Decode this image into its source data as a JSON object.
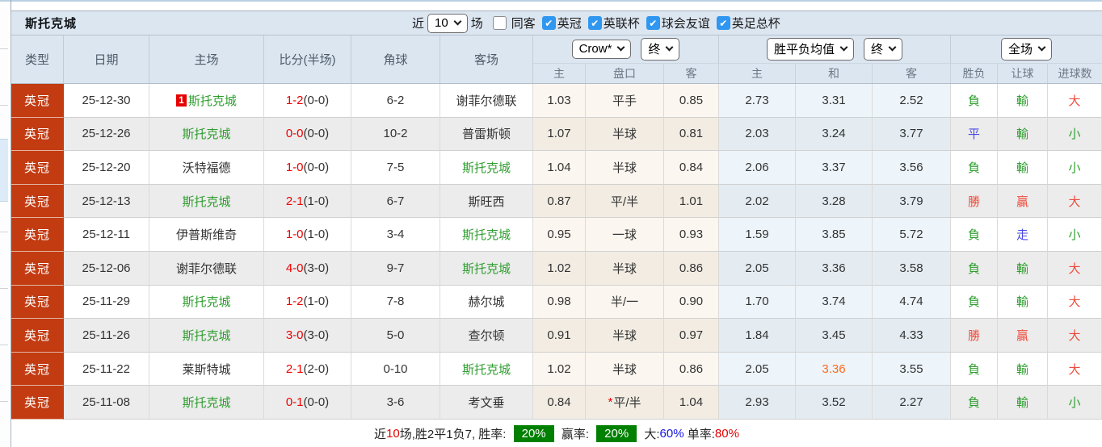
{
  "title": "斯托克城",
  "controls": {
    "near_label": "近",
    "near_value": "10",
    "games_label": "场",
    "filters": [
      {
        "label": "同客",
        "checked": false
      },
      {
        "label": "英冠",
        "checked": true
      },
      {
        "label": "英联杯",
        "checked": true
      },
      {
        "label": "球会友谊",
        "checked": true
      },
      {
        "label": "英足总杯",
        "checked": true
      }
    ]
  },
  "header": {
    "main_columns": [
      "类型",
      "日期",
      "主场",
      "比分(半场)",
      "角球",
      "客场"
    ],
    "groups": [
      {
        "selects": [
          "Crow*",
          "终"
        ],
        "sub": [
          "主",
          "盘口",
          "客"
        ]
      },
      {
        "selects": [
          "胜平负均值",
          "终"
        ],
        "sub": [
          "主",
          "和",
          "客"
        ]
      },
      {
        "selects": [
          "全场"
        ],
        "sub": [
          "胜负",
          "让球",
          "进球数"
        ]
      }
    ]
  },
  "rows": [
    {
      "type": "英冠",
      "date": "25-12-30",
      "badge": "1",
      "home": "斯托克城",
      "home_color": "green",
      "score": "1-2",
      "half": "(0-0)",
      "corner": "6-2",
      "away": "谢菲尔德联",
      "away_color": "dark",
      "odds_home": "1.03",
      "handicap": "平手",
      "odds_away": "0.85",
      "avg_home": "2.73",
      "avg_draw": "3.31",
      "avg_away": "2.52",
      "result_wdl": "負",
      "result_wdl_color": "green",
      "result_handicap": "輸",
      "result_handicap_color": "green",
      "result_goals": "大",
      "result_goals_color": "red"
    },
    {
      "type": "英冠",
      "date": "25-12-26",
      "home": "斯托克城",
      "home_color": "green",
      "score": "0-0",
      "half": "(0-0)",
      "corner": "10-2",
      "away": "普雷斯顿",
      "away_color": "dark",
      "odds_home": "1.07",
      "handicap": "半球",
      "odds_away": "0.81",
      "avg_home": "2.03",
      "avg_draw": "3.24",
      "avg_away": "3.77",
      "result_wdl": "平",
      "result_wdl_color": "blue",
      "result_handicap": "輸",
      "result_handicap_color": "green",
      "result_goals": "小",
      "result_goals_color": "green"
    },
    {
      "type": "英冠",
      "date": "25-12-20",
      "home": "沃特福德",
      "home_color": "dark",
      "score": "1-0",
      "half": "(0-0)",
      "corner": "7-5",
      "away": "斯托克城",
      "away_color": "green",
      "odds_home": "1.04",
      "handicap": "半球",
      "odds_away": "0.84",
      "avg_home": "2.06",
      "avg_draw": "3.37",
      "avg_away": "3.56",
      "result_wdl": "負",
      "result_wdl_color": "green",
      "result_handicap": "輸",
      "result_handicap_color": "green",
      "result_goals": "小",
      "result_goals_color": "green"
    },
    {
      "type": "英冠",
      "date": "25-12-13",
      "home": "斯托克城",
      "home_color": "green",
      "score": "2-1",
      "half": "(1-0)",
      "corner": "6-7",
      "away": "斯旺西",
      "away_color": "dark",
      "odds_home": "0.87",
      "handicap": "平/半",
      "odds_away": "1.01",
      "avg_home": "2.02",
      "avg_draw": "3.28",
      "avg_away": "3.79",
      "result_wdl": "勝",
      "result_wdl_color": "red",
      "result_handicap": "贏",
      "result_handicap_color": "red",
      "result_goals": "大",
      "result_goals_color": "red"
    },
    {
      "type": "英冠",
      "date": "25-12-11",
      "home": "伊普斯维奇",
      "home_color": "dark",
      "score": "1-0",
      "half": "(1-0)",
      "corner": "3-4",
      "away": "斯托克城",
      "away_color": "green",
      "odds_home": "0.95",
      "handicap": "一球",
      "odds_away": "0.93",
      "avg_home": "1.59",
      "avg_draw": "3.85",
      "avg_away": "5.72",
      "result_wdl": "負",
      "result_wdl_color": "green",
      "result_handicap": "走",
      "result_handicap_color": "blue",
      "result_goals": "小",
      "result_goals_color": "green"
    },
    {
      "type": "英冠",
      "date": "25-12-06",
      "home": "谢菲尔德联",
      "home_color": "dark",
      "score": "4-0",
      "half": "(3-0)",
      "corner": "9-7",
      "away": "斯托克城",
      "away_color": "green",
      "odds_home": "1.02",
      "handicap": "半球",
      "odds_away": "0.86",
      "avg_home": "2.05",
      "avg_draw": "3.36",
      "avg_away": "3.58",
      "result_wdl": "負",
      "result_wdl_color": "green",
      "result_handicap": "輸",
      "result_handicap_color": "green",
      "result_goals": "大",
      "result_goals_color": "red"
    },
    {
      "type": "英冠",
      "date": "25-11-29",
      "home": "斯托克城",
      "home_color": "green",
      "score": "1-2",
      "half": "(1-0)",
      "corner": "7-8",
      "away": "赫尔城",
      "away_color": "dark",
      "odds_home": "0.98",
      "handicap": "半/一",
      "odds_away": "0.90",
      "avg_home": "1.70",
      "avg_draw": "3.74",
      "avg_away": "4.74",
      "result_wdl": "負",
      "result_wdl_color": "green",
      "result_handicap": "輸",
      "result_handicap_color": "green",
      "result_goals": "大",
      "result_goals_color": "red"
    },
    {
      "type": "英冠",
      "date": "25-11-26",
      "home": "斯托克城",
      "home_color": "green",
      "score": "3-0",
      "half": "(3-0)",
      "corner": "5-0",
      "away": "查尔顿",
      "away_color": "dark",
      "odds_home": "0.91",
      "handicap": "半球",
      "odds_away": "0.97",
      "avg_home": "1.84",
      "avg_draw": "3.45",
      "avg_away": "4.33",
      "result_wdl": "勝",
      "result_wdl_color": "red",
      "result_handicap": "贏",
      "result_handicap_color": "red",
      "result_goals": "大",
      "result_goals_color": "red"
    },
    {
      "type": "英冠",
      "date": "25-11-22",
      "home": "莱斯特城",
      "home_color": "dark",
      "score": "2-1",
      "half": "(2-0)",
      "corner": "0-10",
      "away": "斯托克城",
      "away_color": "green",
      "odds_home": "1.02",
      "handicap": "半球",
      "odds_away": "0.86",
      "avg_home": "2.05",
      "avg_draw": "3.36",
      "avg_draw_color": "orange",
      "avg_away": "3.55",
      "result_wdl": "負",
      "result_wdl_color": "green",
      "result_handicap": "輸",
      "result_handicap_color": "green",
      "result_goals": "大",
      "result_goals_color": "red"
    },
    {
      "type": "英冠",
      "date": "25-11-08",
      "home": "斯托克城",
      "home_color": "green",
      "score": "0-1",
      "half": "(0-0)",
      "corner": "3-6",
      "away": "考文垂",
      "away_color": "dark",
      "odds_home": "0.84",
      "handicap_star_text": "*",
      "handicap": "平/半",
      "odds_away": "1.04",
      "avg_home": "2.93",
      "avg_draw": "3.52",
      "avg_away": "2.27",
      "result_wdl": "負",
      "result_wdl_color": "green",
      "result_handicap": "輸",
      "result_handicap_color": "green",
      "result_goals": "小",
      "result_goals_color": "green"
    }
  ],
  "footer": {
    "segments": [
      {
        "t": "近",
        "c": "dark"
      },
      {
        "t": "10",
        "c": "red"
      },
      {
        "t": "场,胜2平1负7, 胜率: ",
        "c": "dark"
      },
      {
        "t": "20%",
        "c": "badge"
      },
      {
        "t": " 赢率: ",
        "c": "dark"
      },
      {
        "t": "20%",
        "c": "badge"
      },
      {
        "t": " 大:",
        "c": "dark"
      },
      {
        "t": "60%",
        "c": "blue"
      },
      {
        "t": " 单率:",
        "c": "dark"
      },
      {
        "t": "80%",
        "c": "red"
      }
    ]
  }
}
